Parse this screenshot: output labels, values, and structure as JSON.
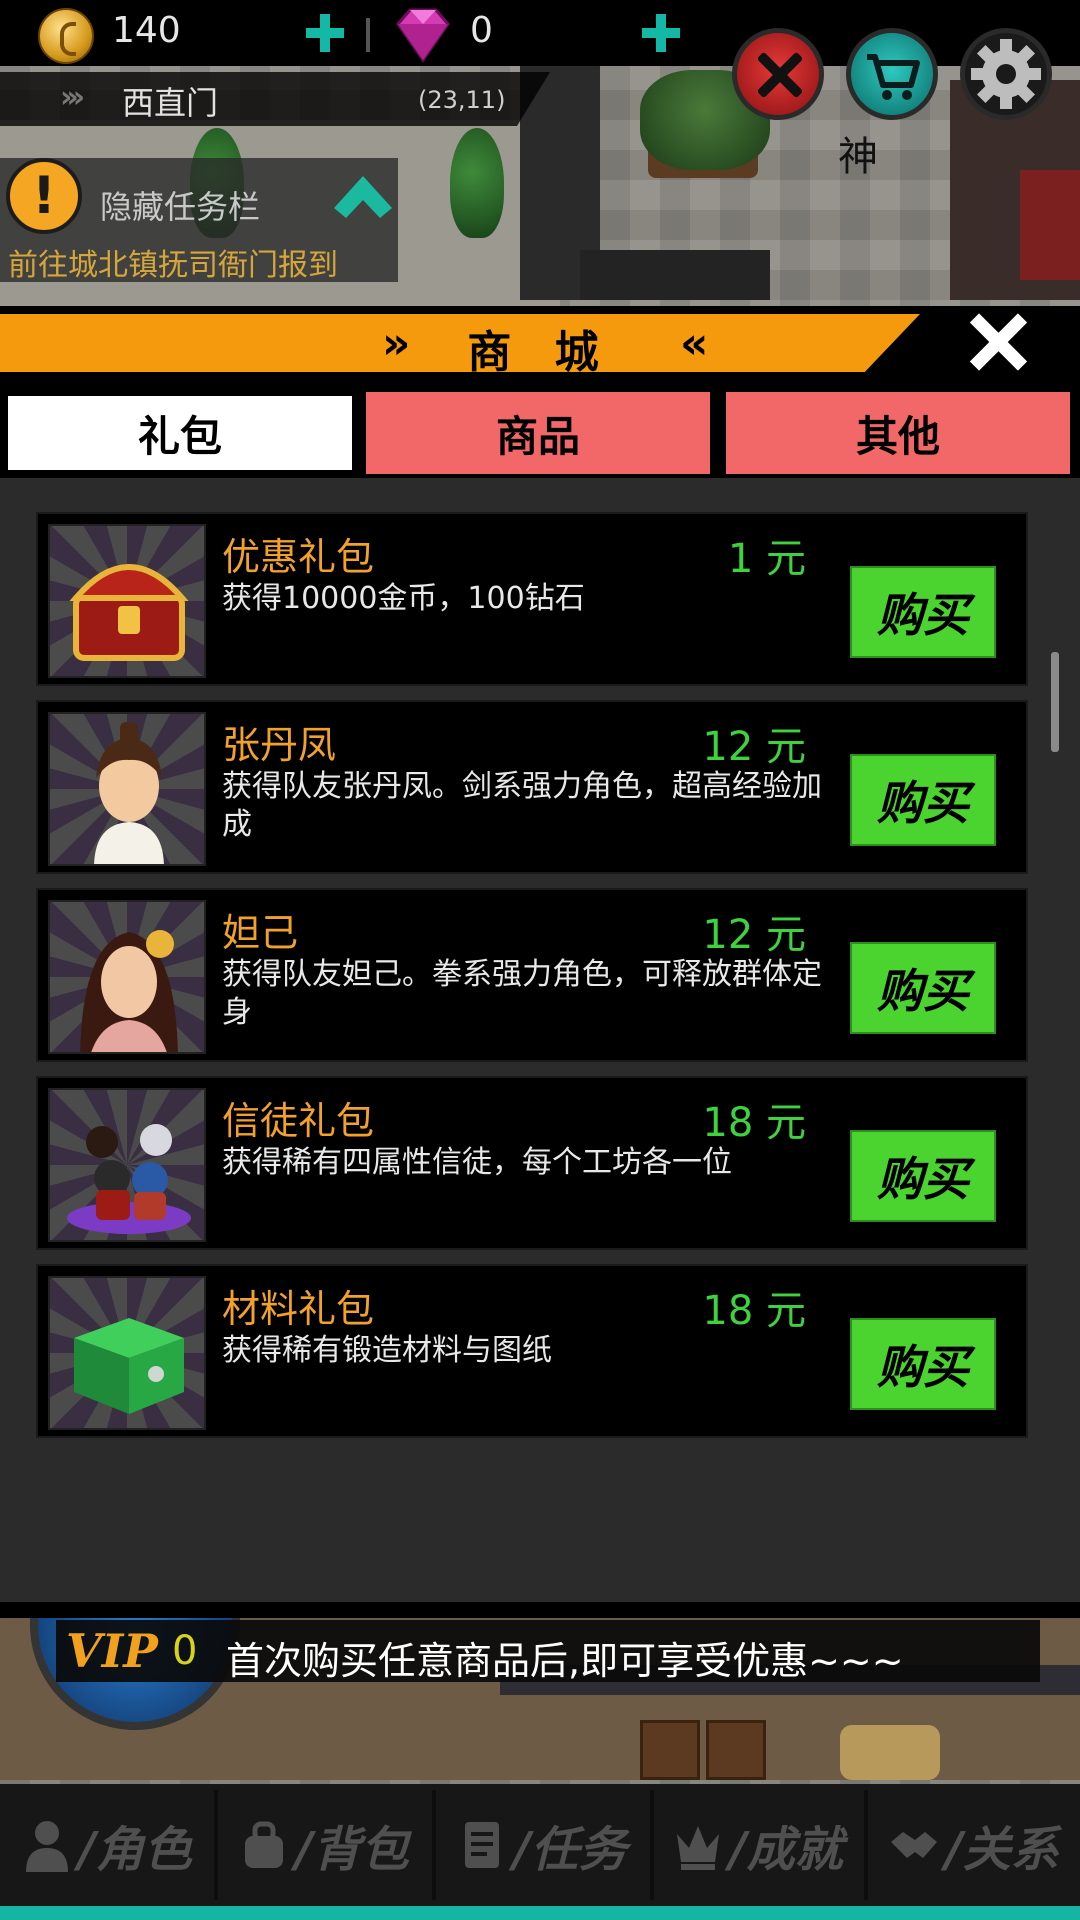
{
  "hud": {
    "gold_value": "140",
    "gem_value": "0",
    "god_text": "神"
  },
  "location": {
    "name": "西直门",
    "coords": "(23,11)"
  },
  "quest": {
    "warn_symbol": "!",
    "title": "隐藏任务栏",
    "description": "前往城北镇抚司衙门报到"
  },
  "shop": {
    "title": "商 城",
    "title_left_marks": "»",
    "title_right_marks": "«",
    "tabs": [
      {
        "label": "礼包"
      },
      {
        "label": "商品"
      },
      {
        "label": "其他"
      }
    ],
    "items": [
      {
        "name": "优惠礼包",
        "price": "1 元",
        "description": "获得10000金币，100钻石",
        "buy_label": "购买"
      },
      {
        "name": "张丹凤",
        "price": "12 元",
        "description": "获得队友张丹凤。剑系强力角色，超高经验加成",
        "buy_label": "购买"
      },
      {
        "name": "妲己",
        "price": "12 元",
        "description": "获得队友妲己。拳系强力角色，可释放群体定身",
        "buy_label": "购买"
      },
      {
        "name": "信徒礼包",
        "price": "18 元",
        "description": "获得稀有四属性信徒，每个工坊各一位",
        "buy_label": "购买"
      },
      {
        "name": "材料礼包",
        "price": "18 元",
        "description": "获得稀有锻造材料与图纸",
        "buy_label": "购买"
      }
    ]
  },
  "vip": {
    "label": "VIP",
    "level": "0",
    "message": "首次购买任意商品后,即可享受优惠~~~"
  },
  "nav": [
    {
      "label": "/角色",
      "icon": "person-icon"
    },
    {
      "label": "/背包",
      "icon": "bag-icon"
    },
    {
      "label": "/任务",
      "icon": "scroll-icon"
    },
    {
      "label": "/成就",
      "icon": "crown-icon"
    },
    {
      "label": "/关系",
      "icon": "handshake-icon"
    }
  ],
  "colors": {
    "accent_orange": "#f59a0c",
    "tab_active": "#ffffff",
    "tab_inactive": "#f26868",
    "buy_green": "#4bd32f",
    "price_green": "#3fd23f",
    "item_name": "#f2a12a",
    "nav_accent": "#16b5a3"
  }
}
